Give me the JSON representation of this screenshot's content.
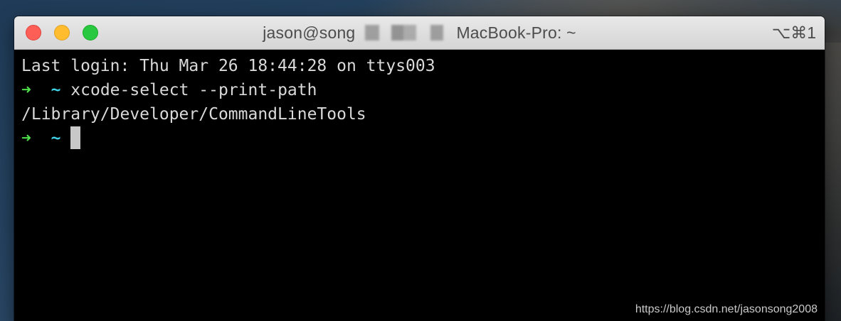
{
  "window": {
    "title_prefix": "jason@song",
    "title_suffix": "MacBook-Pro: ~",
    "shortcut": "⌥⌘1"
  },
  "terminal": {
    "lines": [
      {
        "text": "Last login: Thu Mar 26 18:44:28 on ttys003"
      },
      {
        "prompt_arrow": "➜",
        "prompt_dir": "~",
        "command": "xcode-select --print-path"
      },
      {
        "text": "/Library/Developer/CommandLineTools"
      },
      {
        "prompt_arrow": "➜",
        "prompt_dir": "~",
        "command": ""
      }
    ]
  },
  "watermark": "https://blog.csdn.net/jasonsong2008",
  "colors": {
    "prompt_arrow": "#4ee04a",
    "prompt_dir": "#3fd0e6",
    "terminal_bg": "#000000",
    "terminal_fg": "#d9d9d9"
  }
}
